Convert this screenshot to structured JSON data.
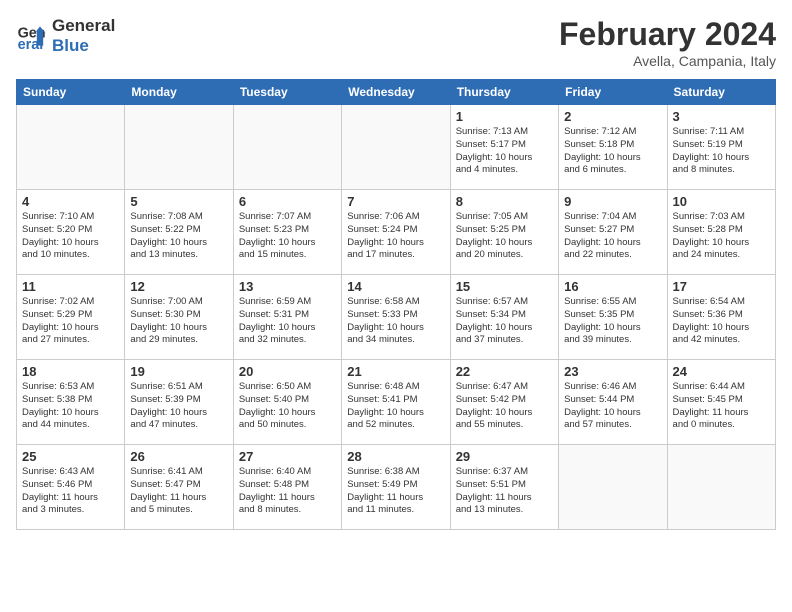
{
  "logo": {
    "line1": "General",
    "line2": "Blue"
  },
  "title": "February 2024",
  "subtitle": "Avella, Campania, Italy",
  "days_of_week": [
    "Sunday",
    "Monday",
    "Tuesday",
    "Wednesday",
    "Thursday",
    "Friday",
    "Saturday"
  ],
  "weeks": [
    [
      {
        "day": "",
        "info": ""
      },
      {
        "day": "",
        "info": ""
      },
      {
        "day": "",
        "info": ""
      },
      {
        "day": "",
        "info": ""
      },
      {
        "day": "1",
        "info": "Sunrise: 7:13 AM\nSunset: 5:17 PM\nDaylight: 10 hours\nand 4 minutes."
      },
      {
        "day": "2",
        "info": "Sunrise: 7:12 AM\nSunset: 5:18 PM\nDaylight: 10 hours\nand 6 minutes."
      },
      {
        "day": "3",
        "info": "Sunrise: 7:11 AM\nSunset: 5:19 PM\nDaylight: 10 hours\nand 8 minutes."
      }
    ],
    [
      {
        "day": "4",
        "info": "Sunrise: 7:10 AM\nSunset: 5:20 PM\nDaylight: 10 hours\nand 10 minutes."
      },
      {
        "day": "5",
        "info": "Sunrise: 7:08 AM\nSunset: 5:22 PM\nDaylight: 10 hours\nand 13 minutes."
      },
      {
        "day": "6",
        "info": "Sunrise: 7:07 AM\nSunset: 5:23 PM\nDaylight: 10 hours\nand 15 minutes."
      },
      {
        "day": "7",
        "info": "Sunrise: 7:06 AM\nSunset: 5:24 PM\nDaylight: 10 hours\nand 17 minutes."
      },
      {
        "day": "8",
        "info": "Sunrise: 7:05 AM\nSunset: 5:25 PM\nDaylight: 10 hours\nand 20 minutes."
      },
      {
        "day": "9",
        "info": "Sunrise: 7:04 AM\nSunset: 5:27 PM\nDaylight: 10 hours\nand 22 minutes."
      },
      {
        "day": "10",
        "info": "Sunrise: 7:03 AM\nSunset: 5:28 PM\nDaylight: 10 hours\nand 24 minutes."
      }
    ],
    [
      {
        "day": "11",
        "info": "Sunrise: 7:02 AM\nSunset: 5:29 PM\nDaylight: 10 hours\nand 27 minutes."
      },
      {
        "day": "12",
        "info": "Sunrise: 7:00 AM\nSunset: 5:30 PM\nDaylight: 10 hours\nand 29 minutes."
      },
      {
        "day": "13",
        "info": "Sunrise: 6:59 AM\nSunset: 5:31 PM\nDaylight: 10 hours\nand 32 minutes."
      },
      {
        "day": "14",
        "info": "Sunrise: 6:58 AM\nSunset: 5:33 PM\nDaylight: 10 hours\nand 34 minutes."
      },
      {
        "day": "15",
        "info": "Sunrise: 6:57 AM\nSunset: 5:34 PM\nDaylight: 10 hours\nand 37 minutes."
      },
      {
        "day": "16",
        "info": "Sunrise: 6:55 AM\nSunset: 5:35 PM\nDaylight: 10 hours\nand 39 minutes."
      },
      {
        "day": "17",
        "info": "Sunrise: 6:54 AM\nSunset: 5:36 PM\nDaylight: 10 hours\nand 42 minutes."
      }
    ],
    [
      {
        "day": "18",
        "info": "Sunrise: 6:53 AM\nSunset: 5:38 PM\nDaylight: 10 hours\nand 44 minutes."
      },
      {
        "day": "19",
        "info": "Sunrise: 6:51 AM\nSunset: 5:39 PM\nDaylight: 10 hours\nand 47 minutes."
      },
      {
        "day": "20",
        "info": "Sunrise: 6:50 AM\nSunset: 5:40 PM\nDaylight: 10 hours\nand 50 minutes."
      },
      {
        "day": "21",
        "info": "Sunrise: 6:48 AM\nSunset: 5:41 PM\nDaylight: 10 hours\nand 52 minutes."
      },
      {
        "day": "22",
        "info": "Sunrise: 6:47 AM\nSunset: 5:42 PM\nDaylight: 10 hours\nand 55 minutes."
      },
      {
        "day": "23",
        "info": "Sunrise: 6:46 AM\nSunset: 5:44 PM\nDaylight: 10 hours\nand 57 minutes."
      },
      {
        "day": "24",
        "info": "Sunrise: 6:44 AM\nSunset: 5:45 PM\nDaylight: 11 hours\nand 0 minutes."
      }
    ],
    [
      {
        "day": "25",
        "info": "Sunrise: 6:43 AM\nSunset: 5:46 PM\nDaylight: 11 hours\nand 3 minutes."
      },
      {
        "day": "26",
        "info": "Sunrise: 6:41 AM\nSunset: 5:47 PM\nDaylight: 11 hours\nand 5 minutes."
      },
      {
        "day": "27",
        "info": "Sunrise: 6:40 AM\nSunset: 5:48 PM\nDaylight: 11 hours\nand 8 minutes."
      },
      {
        "day": "28",
        "info": "Sunrise: 6:38 AM\nSunset: 5:49 PM\nDaylight: 11 hours\nand 11 minutes."
      },
      {
        "day": "29",
        "info": "Sunrise: 6:37 AM\nSunset: 5:51 PM\nDaylight: 11 hours\nand 13 minutes."
      },
      {
        "day": "",
        "info": ""
      },
      {
        "day": "",
        "info": ""
      }
    ]
  ]
}
